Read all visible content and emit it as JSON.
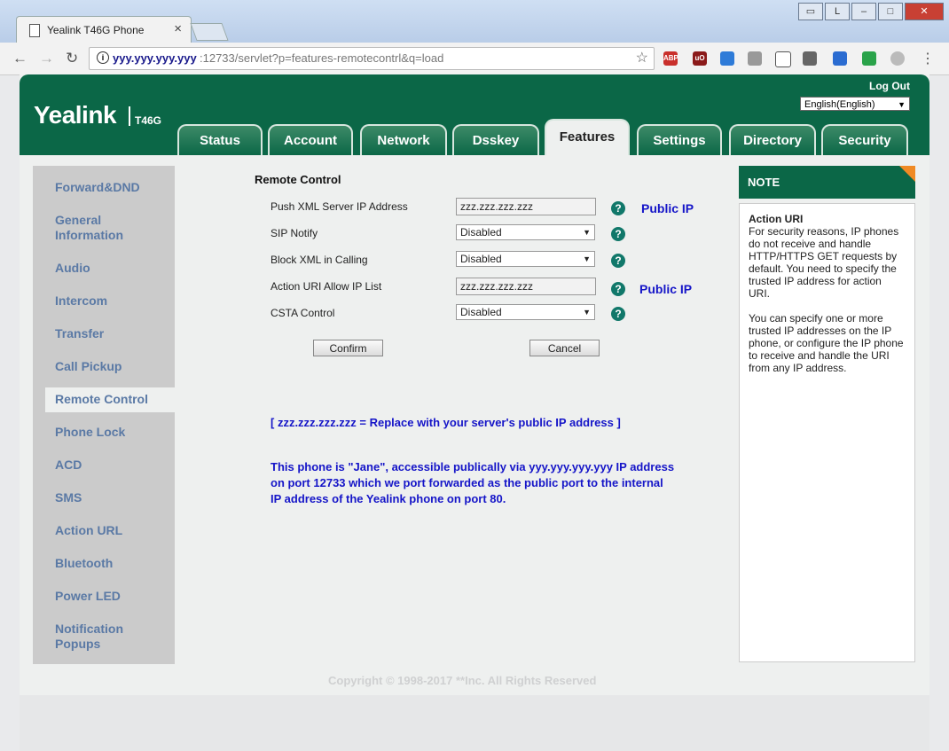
{
  "browser": {
    "tab_title": "Yealink T46G Phone",
    "tab_close": "×",
    "url_host": "yyy.yyy.yyy.yyy",
    "url_path": ":12733/servlet?p=features-remotecontrl&q=load"
  },
  "header": {
    "brand": "Yealink",
    "model": "T46G",
    "logout": "Log Out",
    "language": "English(English)"
  },
  "nav_tabs": [
    "Status",
    "Account",
    "Network",
    "Dsskey",
    "Features",
    "Settings",
    "Directory",
    "Security"
  ],
  "active_tab": "Features",
  "sidebar": [
    "Forward&DND",
    "General Information",
    "Audio",
    "Intercom",
    "Transfer",
    "Call Pickup",
    "Remote Control",
    "Phone Lock",
    "ACD",
    "SMS",
    "Action URL",
    "Bluetooth",
    "Power LED",
    "Notification Popups"
  ],
  "active_sidebar": "Remote Control",
  "form": {
    "title": "Remote Control",
    "push_xml_label": "Push XML Server IP Address",
    "push_xml_value": "zzz.zzz.zzz.zzz",
    "sip_notify_label": "SIP Notify",
    "sip_notify_value": "Disabled",
    "block_xml_label": "Block XML in Calling",
    "block_xml_value": "Disabled",
    "action_uri_label": "Action URI Allow IP List",
    "action_uri_value": "zzz.zzz.zzz.zzz",
    "csta_label": "CSTA Control",
    "csta_value": "Disabled",
    "help_glyph": "?",
    "public_ip_1": "Public IP",
    "public_ip_2": "Public IP",
    "confirm": "Confirm",
    "cancel": "Cancel"
  },
  "annotations": {
    "replace_note": "[ zzz.zzz.zzz.zzz = Replace with your server's public IP address ]",
    "jane_line1": "This phone is \"Jane\", accessible publically via yyy.yyy.yyy.yyy IP address",
    "jane_line2": "on port 12733 which we port forwarded as the public port to the internal",
    "jane_line3": "IP address of the Yealink phone on port 80."
  },
  "note": {
    "header": "NOTE",
    "title": "Action URI",
    "para1": "For security reasons, IP phones do not receive and handle HTTP/HTTPS GET requests by default. You need to specify the trusted IP address for action URI.",
    "para2": "You can specify one or more trusted IP addresses on the IP phone, or configure the IP phone to receive and handle the URI from any IP address."
  },
  "footer": {
    "copyright": "Copyright © 1998-2017 **Inc. All Rights Reserved"
  },
  "colors": {
    "brand_green": "#0b6747",
    "link_blue": "#1515c8",
    "sidebar_text": "#5a79a5",
    "note_corner": "#f08a24"
  }
}
